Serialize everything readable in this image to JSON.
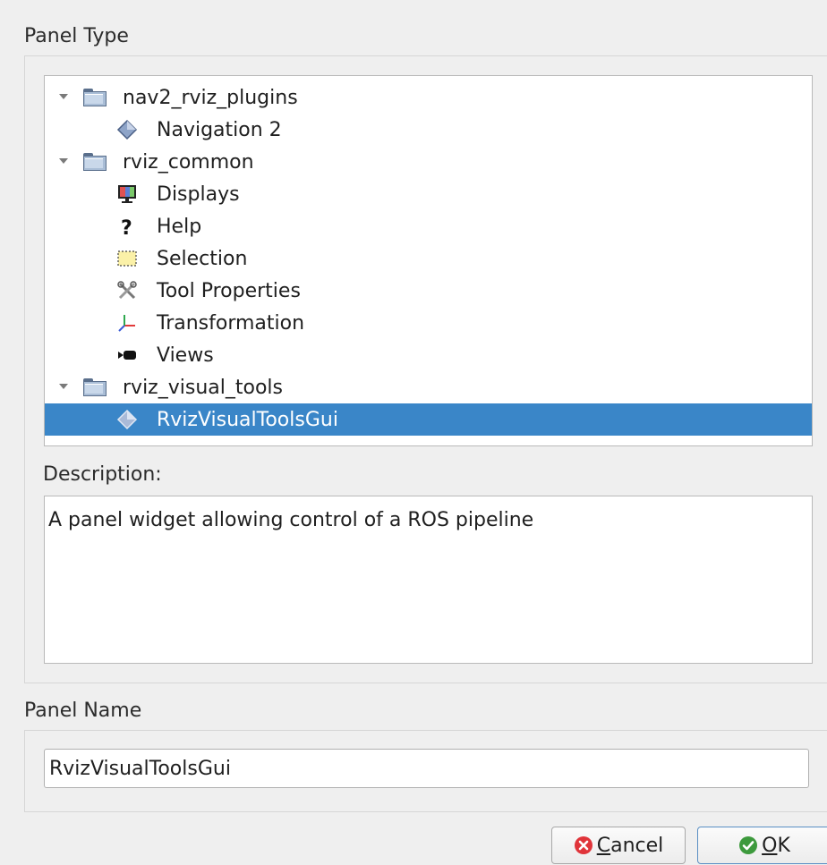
{
  "panel_type_label": "Panel Type",
  "tree": {
    "categories": [
      {
        "name": "nav2_rviz_plugins",
        "items": [
          {
            "label": "Navigation 2",
            "icon": "plugin-diamond-icon"
          }
        ]
      },
      {
        "name": "rviz_common",
        "items": [
          {
            "label": "Displays",
            "icon": "monitor-icon"
          },
          {
            "label": "Help",
            "icon": "question-icon"
          },
          {
            "label": "Selection",
            "icon": "selection-icon"
          },
          {
            "label": "Tool Properties",
            "icon": "tools-icon"
          },
          {
            "label": "Transformation",
            "icon": "axes-icon"
          },
          {
            "label": "Views",
            "icon": "camera-icon"
          }
        ]
      },
      {
        "name": "rviz_visual_tools",
        "items": [
          {
            "label": "RvizVisualToolsGui",
            "icon": "plugin-diamond-icon",
            "selected": true
          }
        ]
      }
    ]
  },
  "description_label": "Description:",
  "description_text": "A panel widget allowing control of a ROS pipeline",
  "panel_name_label": "Panel Name",
  "panel_name_value": "RvizVisualToolsGui",
  "buttons": {
    "cancel_mnemonic": "C",
    "cancel_rest": "ancel",
    "ok_mnemonic": "O",
    "ok_rest": "K"
  },
  "colors": {
    "selection": "#3a86c8",
    "cancel_icon": "#e0343a",
    "ok_icon": "#3d9a3d"
  }
}
